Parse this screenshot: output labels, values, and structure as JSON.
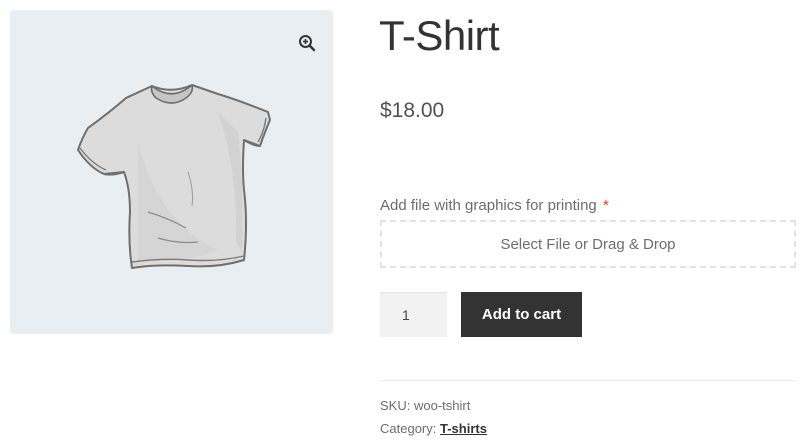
{
  "product": {
    "title": "T-Shirt",
    "price": "$18.00",
    "image": {
      "alt": "T-shirt",
      "icon": "tshirt-image"
    }
  },
  "gallery": {
    "zoom_icon": "zoom-in-icon"
  },
  "upload": {
    "label": "Add file with graphics for printing",
    "required_mark": "*",
    "dropzone_text": "Select File or Drag & Drop"
  },
  "cart": {
    "quantity": "1",
    "add_button": "Add to cart"
  },
  "meta": {
    "sku_label": "SKU:",
    "sku_value": "woo-tshirt",
    "category_label": "Category:",
    "category_value": "T-shirts"
  },
  "colors": {
    "gallery_bg": "#e9eef2",
    "button_bg": "#333333",
    "required": "#e2401c"
  }
}
